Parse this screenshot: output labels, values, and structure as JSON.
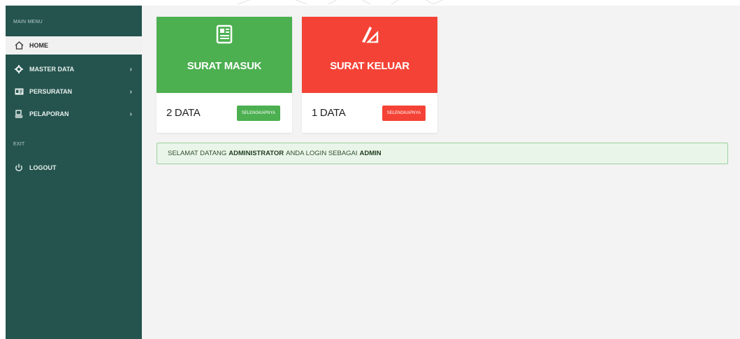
{
  "sidebar": {
    "main_menu_title": "MAIN MENU",
    "items": [
      {
        "label": "HOME",
        "icon": "home-icon",
        "active": true
      },
      {
        "label": "MASTER DATA",
        "icon": "gear-icon",
        "chevron": "›"
      },
      {
        "label": "PERSURATAN",
        "icon": "id-card-icon",
        "chevron": "›"
      },
      {
        "label": "PELAPORAN",
        "icon": "report-icon",
        "chevron": "›"
      }
    ],
    "exit_title": "EXIT",
    "logout_label": "LOGOUT"
  },
  "cards": [
    {
      "title": "SURAT MASUK",
      "count": "2 DATA",
      "button": "SELENGKAPNYA",
      "color": "#4caf50",
      "icon": "document-icon"
    },
    {
      "title": "SURAT KELUAR",
      "count": "1 DATA",
      "button": "SELENGKAPNYA",
      "color": "#f44336",
      "icon": "pen-ruler-icon"
    }
  ],
  "alert": {
    "prefix": "SELAMAT DATANG",
    "user": "ADMINISTRATOR",
    "middle": "ANDA LOGIN SEBAGAI",
    "role": "ADMIN"
  },
  "colors": {
    "sidebar_bg": "#25544f",
    "main_bg": "#f3f3f3",
    "green": "#4caf50",
    "red": "#f44336"
  }
}
